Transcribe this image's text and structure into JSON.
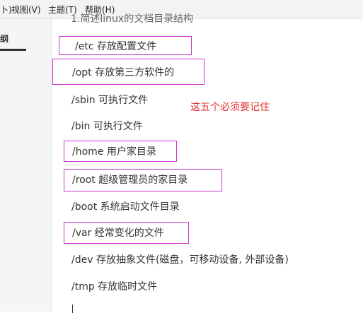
{
  "menu": {
    "partial_left": "卜)",
    "view": "视图(V)",
    "theme": "主题(T)",
    "help": "帮助(H)"
  },
  "sidebar": {
    "label": "纲"
  },
  "document": {
    "heading_partial": "1.简述linux的文档目录结构",
    "lines": {
      "etc": "/etc  存放配置文件",
      "opt": "/opt  存放第三方软件的",
      "sbin": "/sbin 可执行文件",
      "bin": "/bin 可执行文件",
      "home": "/home 用户家目录",
      "root": "/root  超级管理员的家目录",
      "boot": "/boot  系统启动文件目录",
      "var": "/var  经常变化的文件",
      "dev": "/dev  存放抽象文件(磁盘，可移动设备, 外部设备)",
      "tmp": "/tmp  存放临时文件"
    },
    "annotation": "这五个必须要记住"
  },
  "colors": {
    "highlight_box": "#cc33cc",
    "annotation": "#e83030",
    "text": "#333333"
  }
}
